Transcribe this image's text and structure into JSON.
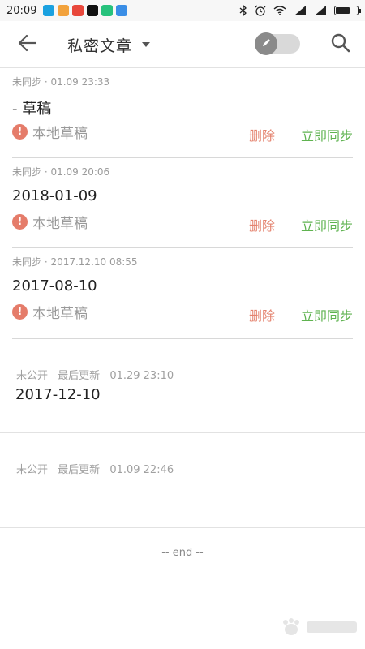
{
  "status_bar": {
    "time": "20:09",
    "app_icons": [
      {
        "name": "app-icon-1",
        "color": "#1aa1e0"
      },
      {
        "name": "app-icon-2",
        "color": "#f2a23c"
      },
      {
        "name": "app-icon-3",
        "color": "#e8473b"
      },
      {
        "name": "app-icon-4",
        "color": "#111111"
      },
      {
        "name": "app-icon-5",
        "color": "#27c27c"
      },
      {
        "name": "app-icon-6",
        "color": "#3a8ee6"
      }
    ]
  },
  "header": {
    "title": "私密文章",
    "back_icon": "arrow-left-icon",
    "search_icon": "search-icon",
    "toggle_icon": "pencil-icon"
  },
  "drafts": [
    {
      "meta": "未同步 · 01.09 23:33",
      "title": "- 草稿",
      "draft_label": "本地草稿",
      "delete_label": "删除",
      "sync_label": "立即同步"
    },
    {
      "meta": "未同步 · 01.09 20:06",
      "title": "2018-01-09",
      "draft_label": "本地草稿",
      "delete_label": "删除",
      "sync_label": "立即同步"
    },
    {
      "meta": "未同步 · 2017.12.10 08:55",
      "title": "2017-08-10",
      "draft_label": "本地草稿",
      "delete_label": "删除",
      "sync_label": "立即同步"
    }
  ],
  "published": [
    {
      "visibility": "未公开",
      "updated_label": "最后更新",
      "updated_time": "01.29 23:10",
      "title": "2017-12-10"
    },
    {
      "visibility": "未公开",
      "updated_label": "最后更新",
      "updated_time": "01.09 22:46",
      "title": ""
    }
  ],
  "footer": {
    "end_text": "-- end --"
  },
  "colors": {
    "delete": "#e4836f",
    "sync": "#5fb350",
    "warning": "#e57c6a"
  }
}
